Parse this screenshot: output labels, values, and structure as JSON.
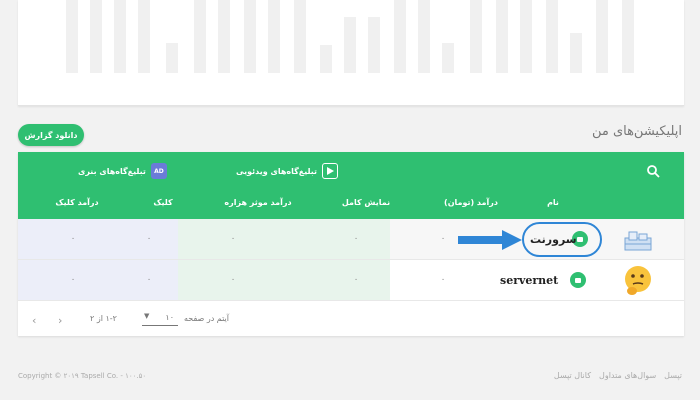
{
  "section_title": "اپلیکیشن‌های من",
  "download_button": "دانلود گزارش",
  "table": {
    "group_game_ads": "تبلیغ‌گاه‌های بنری",
    "group_video_ads": "تبلیغ‌گاه‌های ویدئویی",
    "headers": {
      "name": "نام",
      "income_toman": "درآمد (تومان)",
      "full_view": "نمایش کامل",
      "ecpm": "درآمد موثر هزاره",
      "click": "کلیک",
      "click_income": "درآمد کلیک"
    },
    "rows": [
      {
        "name": "سرورنت",
        "income": "۰",
        "full_view": "۰",
        "ecpm": "۰",
        "click": "۰",
        "click_income": "۰"
      },
      {
        "name": "servernet",
        "income": "۰",
        "full_view": "۰",
        "ecpm": "۰",
        "click": "۰",
        "click_income": "۰"
      }
    ]
  },
  "pagination": {
    "items_per_page_label": "آیتم در صفحه",
    "items_per_page_value": "۱۰",
    "range": "۱-۲ از ۲"
  },
  "footer": {
    "copyright": "Copyright © ۲۰۱۹ Tapsell Co. - ۱۰۰.۵۰",
    "links": [
      "تپسل",
      "سوال‌های متداول",
      "کانال تپسل"
    ]
  },
  "colors": {
    "accent": "#2fbf71",
    "highlight_arrow": "#2f86d6"
  }
}
